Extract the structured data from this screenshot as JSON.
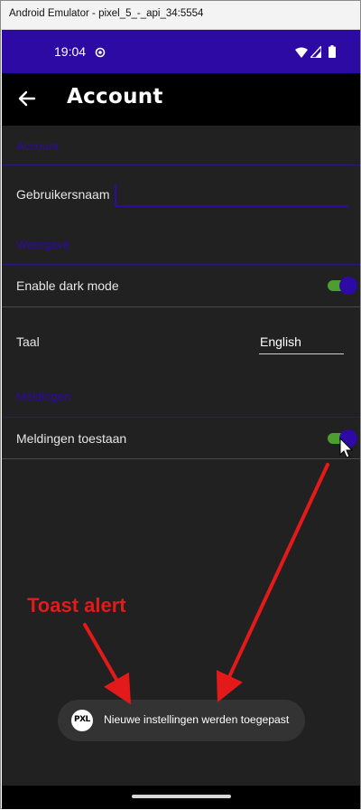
{
  "window": {
    "title": "Android Emulator - pixel_5_-_api_34:5554"
  },
  "status_bar": {
    "time": "19:04"
  },
  "app_bar": {
    "title": "Account"
  },
  "sections": {
    "account": {
      "header": "Account",
      "username_label": "Gebruikersnaam",
      "username_value": ""
    },
    "display": {
      "header": "Weergave",
      "dark_mode_label": "Enable dark mode",
      "dark_mode_on": true,
      "language_label": "Taal",
      "language_value": "English"
    },
    "notifications": {
      "header": "Meldingen",
      "allow_label": "Meldingen toestaan",
      "allow_on": true
    }
  },
  "toast": {
    "logo_text": "PXL",
    "message": "Nieuwe instellingen werden toegepast"
  },
  "annotation": {
    "text": "Toast alert"
  },
  "colors": {
    "primary": "#2d0aa3",
    "switch_track": "#4b9e2f",
    "background": "#212121",
    "annotation": "#e41a1a"
  }
}
